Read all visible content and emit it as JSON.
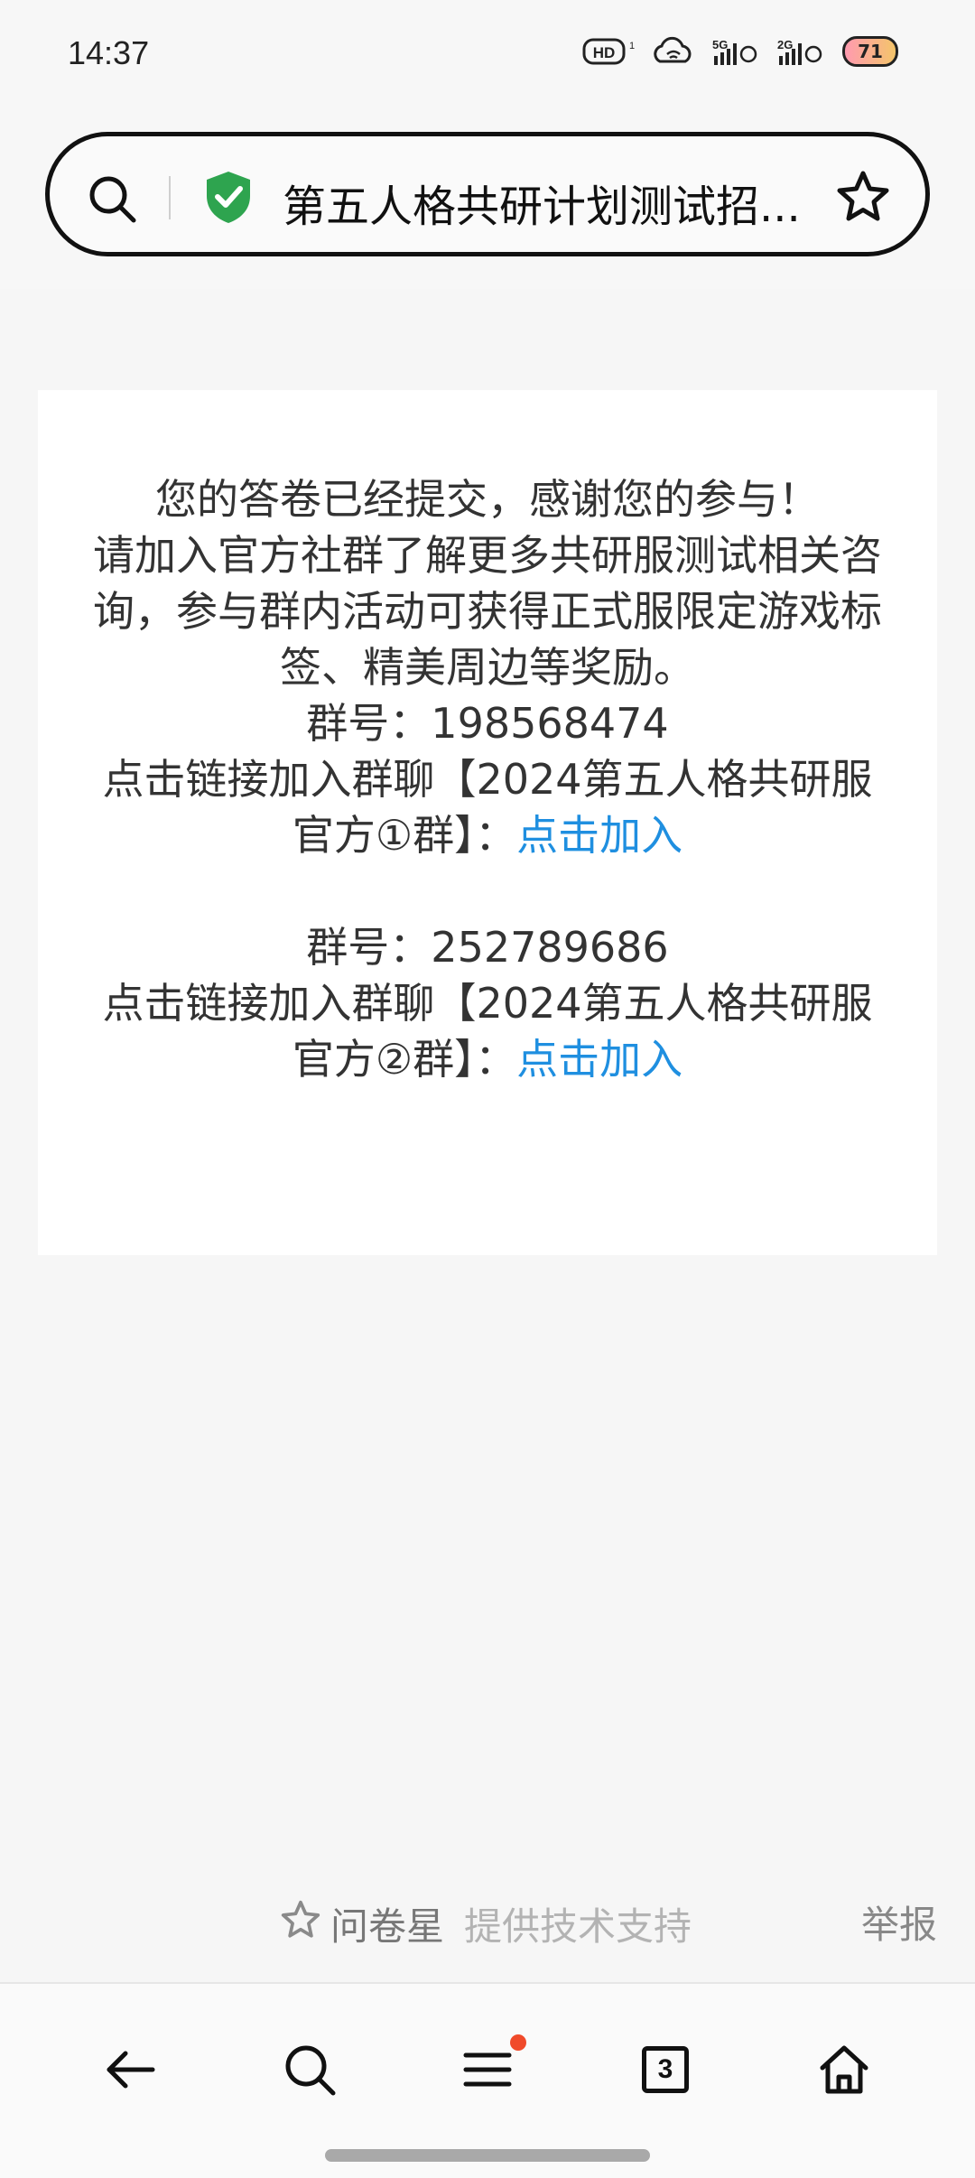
{
  "status_bar": {
    "time": "14:37",
    "battery": "71",
    "hd_label": "HD",
    "signal1_label": "5G",
    "signal2_label": "2G"
  },
  "address_bar": {
    "title": "第五人格共研计划测试招..."
  },
  "message": {
    "line1": "您的答卷已经提交，感谢您的参与！",
    "line2": "请加入官方社群了解更多共研服测试相关咨询，参与群内活动可获得正式服限定游戏标签、精美周边等奖励。",
    "group1_number": "群号：198568474",
    "group1_text": "点击链接加入群聊【2024第五人格共研服官方①群】：",
    "group1_link": "点击加入",
    "group2_number": "群号：252789686",
    "group2_text": "点击链接加入群聊【2024第五人格共研服官方②群】：",
    "group2_link": "点击加入"
  },
  "footer": {
    "brand": "问卷星",
    "tagline": "提供技术支持",
    "report": "举报"
  },
  "bottom_nav": {
    "tab_count": "3"
  }
}
